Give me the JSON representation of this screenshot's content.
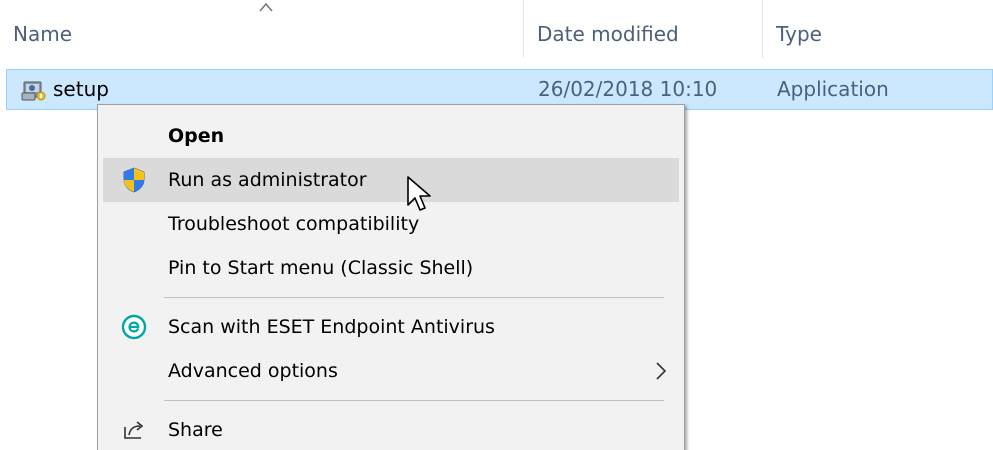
{
  "columns": {
    "name": "Name",
    "date_modified": "Date modified",
    "type": "Type"
  },
  "file": {
    "name": "setup",
    "date_modified": "26/02/2018 10:10",
    "type": "Application",
    "icon": "setup-application-icon"
  },
  "context_menu": {
    "items": [
      {
        "label": "Open",
        "bold": true
      },
      {
        "label": "Run as administrator",
        "icon": "uac-shield-icon",
        "hovered": true
      },
      {
        "label": "Troubleshoot compatibility"
      },
      {
        "label": "Pin to Start menu (Classic Shell)"
      },
      {
        "label": "Scan with ESET Endpoint Antivirus",
        "icon": "eset-icon"
      },
      {
        "label": "Advanced options",
        "submenu": true
      },
      {
        "label": "Share",
        "icon": "share-icon"
      }
    ]
  },
  "colors": {
    "header_text": "#4c607a",
    "selection_bg": "#cce8ff",
    "selection_border": "#99d1ff",
    "menu_bg": "#f2f2f2",
    "menu_hover_bg": "#dadada",
    "eset_accent": "#00a7a7"
  }
}
